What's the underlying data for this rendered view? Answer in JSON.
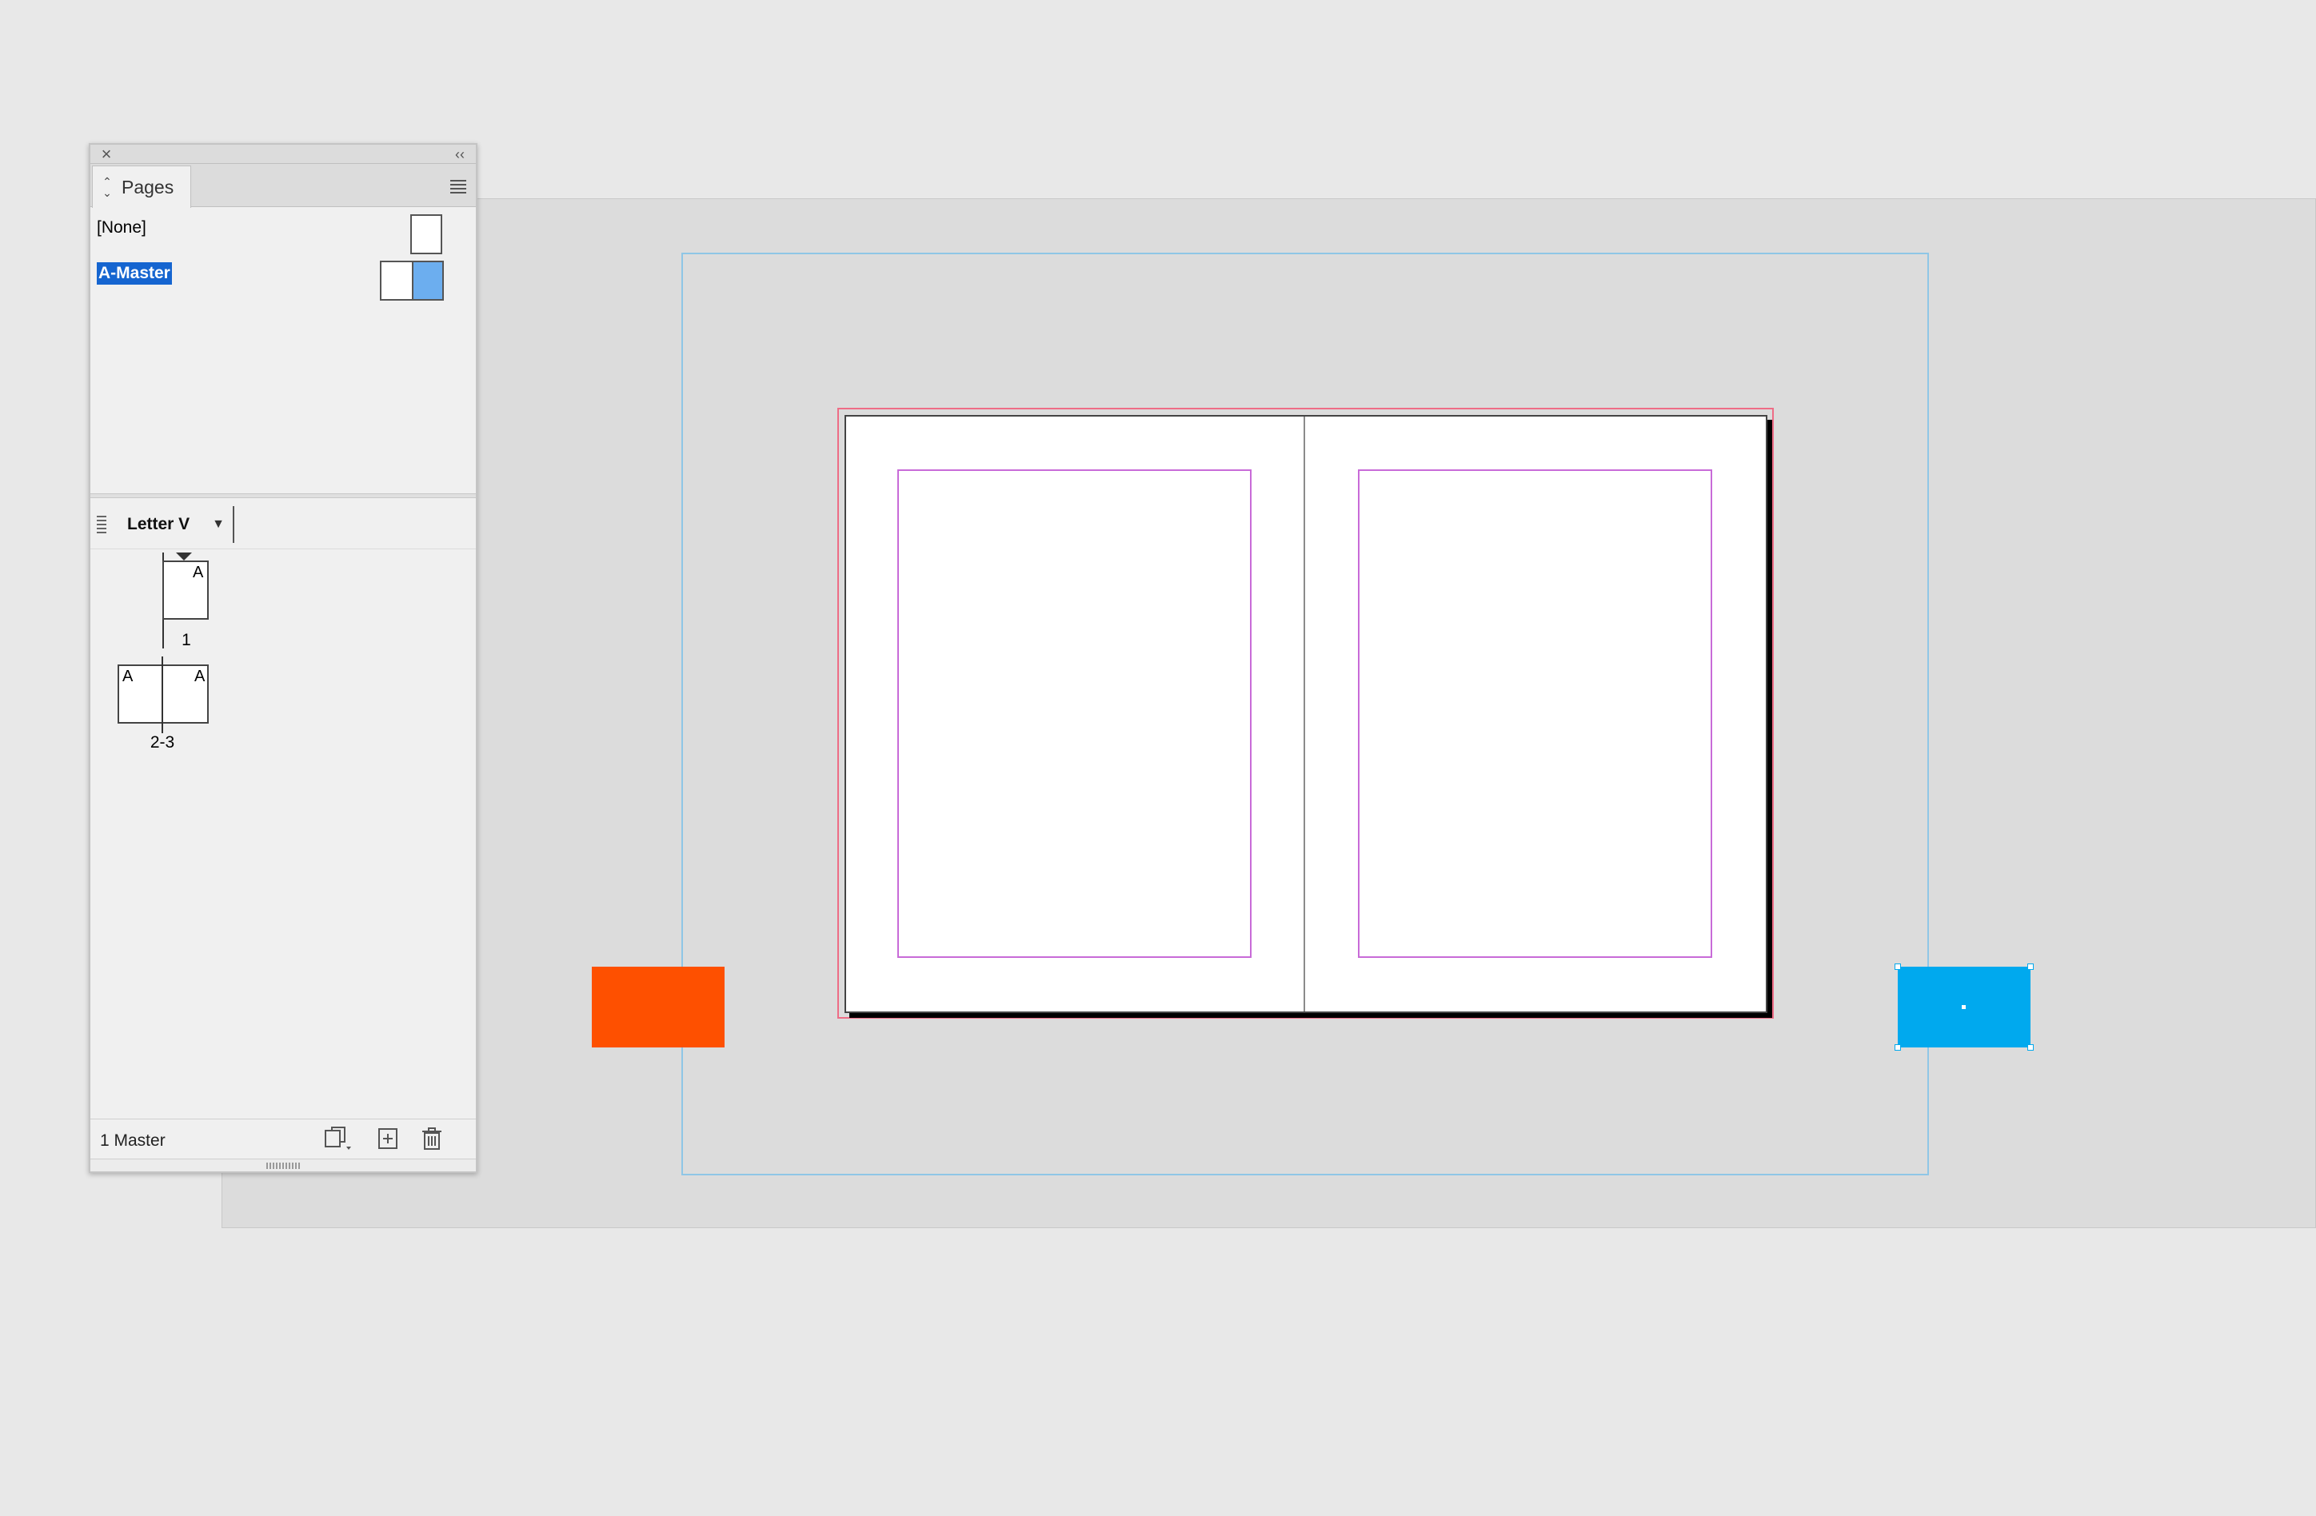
{
  "panel": {
    "title": "Pages",
    "close_icon": "close-icon",
    "collapse_icon": "collapse-double-chevron-icon",
    "collapse_glyph": "‹‹",
    "close_glyph": "×",
    "menu_icon": "panel-menu-icon",
    "masters": [
      {
        "label": "[None]",
        "selected": false
      },
      {
        "label": "A-Master",
        "selected": true
      }
    ],
    "page_size": {
      "label": "Letter V"
    },
    "pages": [
      {
        "number": "1",
        "master_letter": "A",
        "current": true
      },
      {
        "number": "2-3",
        "master_letters": [
          "A",
          "A"
        ]
      }
    ],
    "footer": {
      "status": "1 Master",
      "buttons": [
        "edit-page-size-icon",
        "new-page-icon",
        "trash-icon"
      ]
    }
  },
  "canvas": {
    "colors": {
      "pasteboard": "#dcdcdc",
      "bleed_guide": "#8fc6e6",
      "spread_bleed": "#ee6d86",
      "margin_guide": "#c86bd8",
      "orange_frame": "#fe5000",
      "blue_frame": "#00a9ee",
      "master_selection": "#1565d0"
    }
  }
}
